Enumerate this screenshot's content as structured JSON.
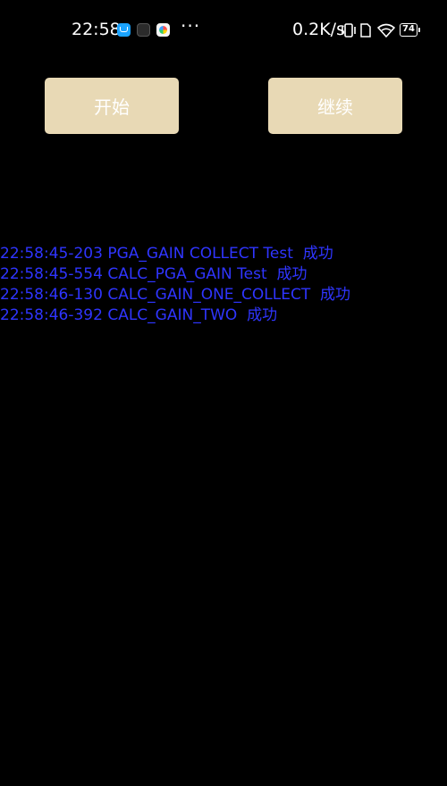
{
  "status_bar": {
    "time": "22:58",
    "more": "···",
    "net_speed": "0.2K/s",
    "battery": "74",
    "app_icons": [
      "notification-app-icon",
      "terminal-app-icon",
      "photos-app-icon"
    ]
  },
  "buttons": {
    "start_label": "开始",
    "continue_label": "继续"
  },
  "log": {
    "lines": [
      "22:58:45-203 PGA_GAIN COLLECT Test  成功",
      "22:58:45-554 CALC_PGA_GAIN Test  成功",
      "22:58:46-130 CALC_GAIN_ONE_COLLECT  成功",
      "22:58:46-392 CALC_GAIN_TWO  成功"
    ]
  },
  "colors": {
    "background": "#000000",
    "button_bg": "#e8d9b5",
    "button_text": "#ffffff",
    "log_text": "#2f35ff"
  }
}
